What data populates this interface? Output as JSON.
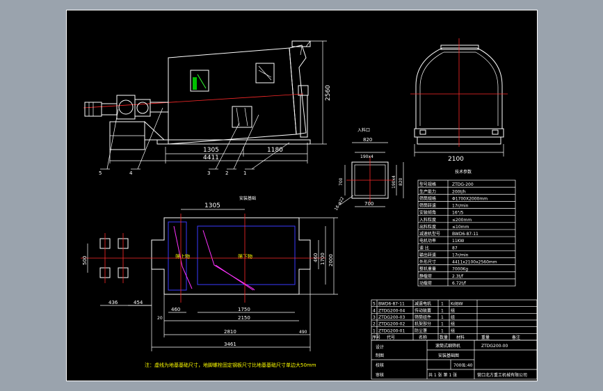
{
  "front_view": {
    "dim_1305": "1305",
    "dim_1180": "1180",
    "dim_4411": "4411",
    "dim_2560": "2560",
    "callouts": [
      "5",
      "4",
      "3",
      "2",
      "1"
    ]
  },
  "inlet_detail": {
    "title": "入料口",
    "dim_820": "820",
    "dim_190x4": "190x4",
    "dim_700_side": "700",
    "dim_190x4_v": "190x4",
    "dim_820_v": "820",
    "dim_700_bottom": "700",
    "hole_note": "16-φ22"
  },
  "side_view": {
    "dim_2100": "2100"
  },
  "foundation": {
    "title": "安装基础",
    "dim_1305": "1305",
    "dim_500": "500",
    "dim_436": "436",
    "dim_454": "454",
    "dim_460_left": "460",
    "dim_1750": "1750",
    "dim_2150": "2150",
    "dim_2810": "2810",
    "dim_490": "490",
    "dim_3461": "3461",
    "dim_20": "20",
    "dim_460_right": "460",
    "dim_1700": "1700",
    "dim_2000": "2000",
    "label_left": "筛上物",
    "label_right": "筛下物",
    "note": "注：虚线为地基基础尺寸，地脚螺栓固定钢板尺寸比地基基础尺寸单边大50mm"
  },
  "tech_params": {
    "title": "技术参数",
    "rows": [
      {
        "k": "型号规格",
        "v": "ZTDG-200"
      },
      {
        "k": "生产能力",
        "v": "200t/h"
      },
      {
        "k": "筛筒规格",
        "v": "Φ1700X2000mm"
      },
      {
        "k": "筛筒转速",
        "v": "17r/min"
      },
      {
        "k": "安装倾角",
        "v": "16°/5"
      },
      {
        "k": "入料粒度",
        "v": "≤200mm"
      },
      {
        "k": "出料粒度",
        "v": "≤10mm"
      },
      {
        "k": "减速机型号",
        "v": "BWD6-87-11"
      },
      {
        "k": "电机功率",
        "v": "11KW"
      },
      {
        "k": "速  比",
        "v": "87"
      },
      {
        "k": "输出转速",
        "v": "17r/min"
      },
      {
        "k": "外形尺寸",
        "v": "4411x2100x2560mm"
      },
      {
        "k": "整机重量",
        "v": "7000Kg"
      },
      {
        "k": "静载荷",
        "v": "2.3t/f"
      },
      {
        "k": "动载荷",
        "v": "6.72t/f"
      }
    ]
  },
  "bom": {
    "rows": [
      {
        "no": "5",
        "code": "BWD6-87-11",
        "name": "减速电机",
        "qty": "1",
        "mat": "KdBW"
      },
      {
        "no": "4",
        "code": "ZTDG200-04",
        "name": "传动装置",
        "qty": "1",
        "mat": "组"
      },
      {
        "no": "3",
        "code": "ZTDG200-03",
        "name": "筛筒组件",
        "qty": "1",
        "mat": "组"
      },
      {
        "no": "2",
        "code": "ZTDG200-02",
        "name": "机架部分",
        "qty": "1",
        "mat": "组"
      },
      {
        "no": "1",
        "code": "ZTDG200-01",
        "name": "防尘罩",
        "qty": "1",
        "mat": "组"
      }
    ],
    "header": {
      "no": "序号",
      "code": "代号",
      "name": "名称",
      "qty": "数量",
      "mat": "材料",
      "weight": "重量",
      "note": "备注"
    }
  },
  "title_block": {
    "product": "滚筒式细筛机",
    "drawing_no": "ZTDG200-00",
    "drawing_name": "安装基础图",
    "weight": "7000",
    "scale": "1:40",
    "sheet": "共 1 张 第 1 张",
    "company": "营口北方重工机械有限公司",
    "roles": [
      "设计",
      "制图",
      "校核",
      "审核"
    ]
  }
}
